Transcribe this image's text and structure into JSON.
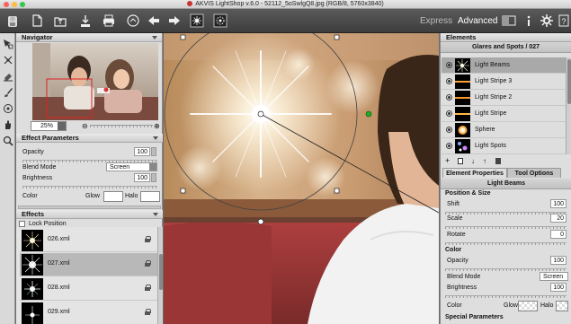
{
  "window": {
    "title": "AKVIS LightShop v.6.0 - 52112_5oSwlgQ8.jpg (RGB/8, 5760x3840)"
  },
  "toolbar": {
    "icons": [
      "app-logo-icon",
      "new-file-icon",
      "open-file-icon",
      "save-icon",
      "print-icon",
      "share-icon",
      "undo-icon",
      "redo-icon",
      "run-icon",
      "batch-icon"
    ],
    "mode_express": "Express",
    "mode_advanced": "Advanced",
    "right_icons": [
      "view-compare-icon",
      "info-icon",
      "settings-icon",
      "help-icon"
    ]
  },
  "tools": [
    "select-tool-icon",
    "transform-tool-icon",
    "eraser-tool-icon",
    "brush-tool-icon",
    "stamp-tool-icon",
    "hand-tool-icon",
    "zoom-tool-icon"
  ],
  "navigator": {
    "title": "Navigator",
    "zoom": "25%"
  },
  "effect_params": {
    "title": "Effect Parameters",
    "opacity_label": "Opacity",
    "opacity_value": "100",
    "blend_label": "Blend Mode",
    "blend_value": "Screen",
    "brightness_label": "Brightness",
    "brightness_value": "100",
    "color_label": "Color",
    "glow_label": "Glow",
    "halo_label": "Halo"
  },
  "effects": {
    "title": "Effects",
    "lock_label": "Lock Position",
    "items": [
      {
        "name": "026.xml",
        "selected": false
      },
      {
        "name": "027.xml",
        "selected": true
      },
      {
        "name": "028.xml",
        "selected": false
      },
      {
        "name": "029.xml",
        "selected": false
      }
    ]
  },
  "elements": {
    "title": "Elements",
    "group_title": "Glares and Spots / 027",
    "items": [
      {
        "name": "Light Beams",
        "selected": true
      },
      {
        "name": "Light Stripe 3",
        "selected": false
      },
      {
        "name": "Light Stripe 2",
        "selected": false
      },
      {
        "name": "Light Stripe",
        "selected": false
      },
      {
        "name": "Sphere",
        "selected": false
      },
      {
        "name": "Light Spots",
        "selected": false
      }
    ],
    "action_icons": [
      "add-element-icon",
      "duplicate-element-icon",
      "move-down-icon",
      "move-up-icon",
      "delete-element-icon"
    ]
  },
  "properties": {
    "tab_element": "Element Properties",
    "tab_tool": "Tool Options",
    "element_name": "Light Beams",
    "position_size": "Position & Size",
    "shift_label": "Shift",
    "shift_value": "100",
    "scale_label": "Scale",
    "scale_value": "20",
    "rotate_label": "Rotate",
    "rotate_value": "0",
    "color_section": "Color",
    "opacity_label": "Opacity",
    "opacity_value": "100",
    "blend_label": "Blend Mode",
    "blend_value": "Screen",
    "brightness_label": "Brightness",
    "brightness_value": "100",
    "color_label": "Color",
    "glow_label": "Glow",
    "halo_label": "Halo",
    "special_section": "Special Parameters"
  },
  "colors": {
    "toolbar": "#464646",
    "panel": "#dedede",
    "selection": "#a9a9a9",
    "control_point": "#22aa22"
  }
}
